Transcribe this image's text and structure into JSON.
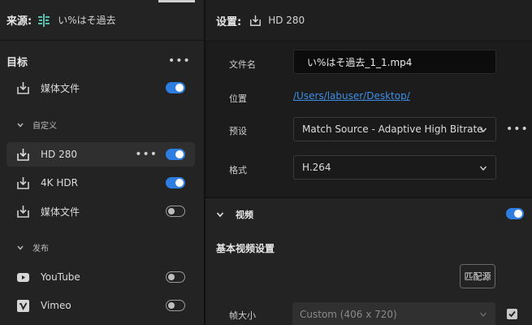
{
  "source": {
    "label": "来源:",
    "name": "い%はそ過去"
  },
  "targets": {
    "title": "目标",
    "more": "•••",
    "top_item": {
      "label": "媒体文件",
      "enabled": true
    },
    "custom_group": "自定义",
    "custom_items": [
      {
        "label": "HD 280",
        "enabled": true,
        "selected": true
      },
      {
        "label": "4K HDR",
        "enabled": true
      },
      {
        "label": "媒体文件",
        "enabled": false
      }
    ],
    "publish_group": "发布",
    "publish_items": [
      {
        "label": "YouTube",
        "enabled": false,
        "icon": "youtube-icon"
      },
      {
        "label": "Vimeo",
        "enabled": false,
        "icon": "vimeo-icon"
      }
    ]
  },
  "settings": {
    "label": "设置:",
    "preset_name": "HD 280",
    "filename_label": "文件名",
    "filename_value": "い%はそ過去_1_1.mp4",
    "location_label": "位置",
    "location_value": "/Users/labuser/Desktop/",
    "preset_label": "预设",
    "preset_value": "Match Source - Adaptive High Bitrate",
    "preset_more": "•••",
    "format_label": "格式",
    "format_value": "H.264"
  },
  "video": {
    "section_label": "视频",
    "enabled": true,
    "basic_title": "基本视频设置",
    "match_button": "匹配源",
    "frame_size_label": "帧大小",
    "frame_size_value": "Custom (406 x 720)",
    "frame_size_checked": true
  },
  "colors": {
    "accent": "#2e7de0",
    "link": "#3d8fe6"
  }
}
